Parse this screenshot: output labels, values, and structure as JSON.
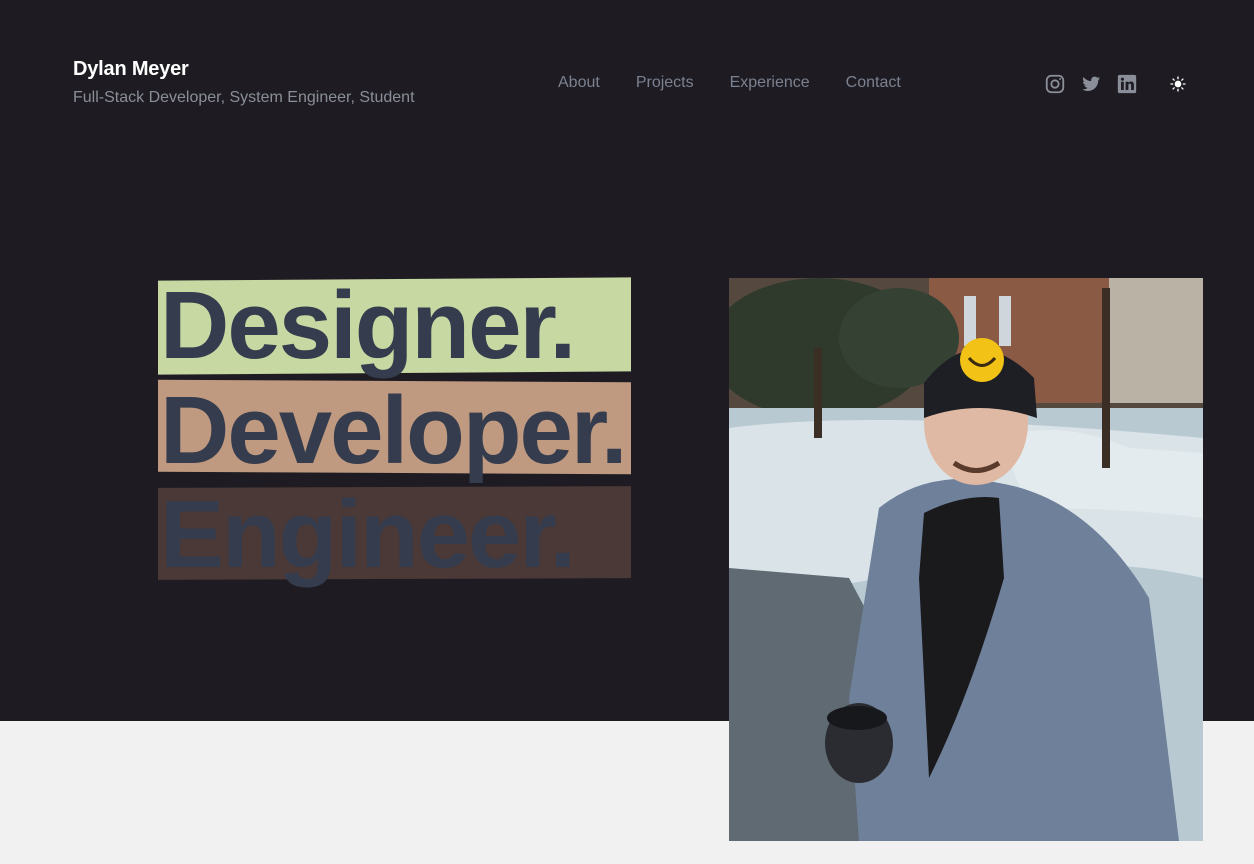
{
  "header": {
    "name": "Dylan Meyer",
    "tagline": "Full-Stack Developer, System Engineer, Student"
  },
  "nav": {
    "items": [
      "About",
      "Projects",
      "Experience",
      "Contact"
    ]
  },
  "socials": {
    "icons": [
      "instagram-icon",
      "twitter-icon",
      "linkedin-icon"
    ],
    "theme_toggle_icon": "sun-icon"
  },
  "hero": {
    "words": [
      "Designer.",
      "Developer.",
      "Engineer."
    ],
    "highlight_colors": [
      "#c8d8a3",
      "#bf9a80",
      "#4a3936"
    ],
    "text_color": "#353c4d"
  },
  "colors": {
    "dark_bg": "#1e1c22",
    "light_bg": "#f1f1f1",
    "nav_text": "#7b8190"
  }
}
